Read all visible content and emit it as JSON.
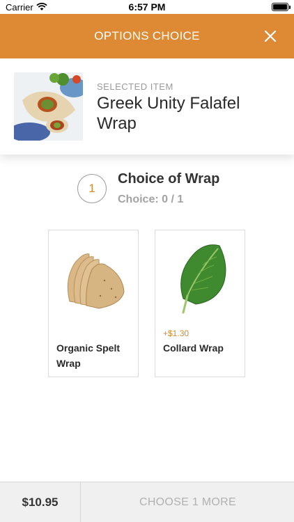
{
  "status_bar": {
    "carrier": "Carrier",
    "time": "6:57 PM"
  },
  "header": {
    "title": "OPTIONS CHOICE",
    "close_icon": "close-icon",
    "background": "#de8a35"
  },
  "selected_item": {
    "caption": "SELECTED ITEM",
    "name": "Greek Unity Falafel Wrap"
  },
  "choice": {
    "step_number": "1",
    "title": "Choice of Wrap",
    "count_label": "Choice: 0 / 1"
  },
  "options": [
    {
      "name": "Organic Spelt Wrap",
      "price": ""
    },
    {
      "name": "Collard Wrap",
      "price": "+$1.30"
    }
  ],
  "footer": {
    "total": "$10.95",
    "action_label": "CHOOSE 1 MORE"
  },
  "colors": {
    "accent": "#de8a35",
    "price": "#d5892f",
    "muted": "#a3a3a3"
  }
}
